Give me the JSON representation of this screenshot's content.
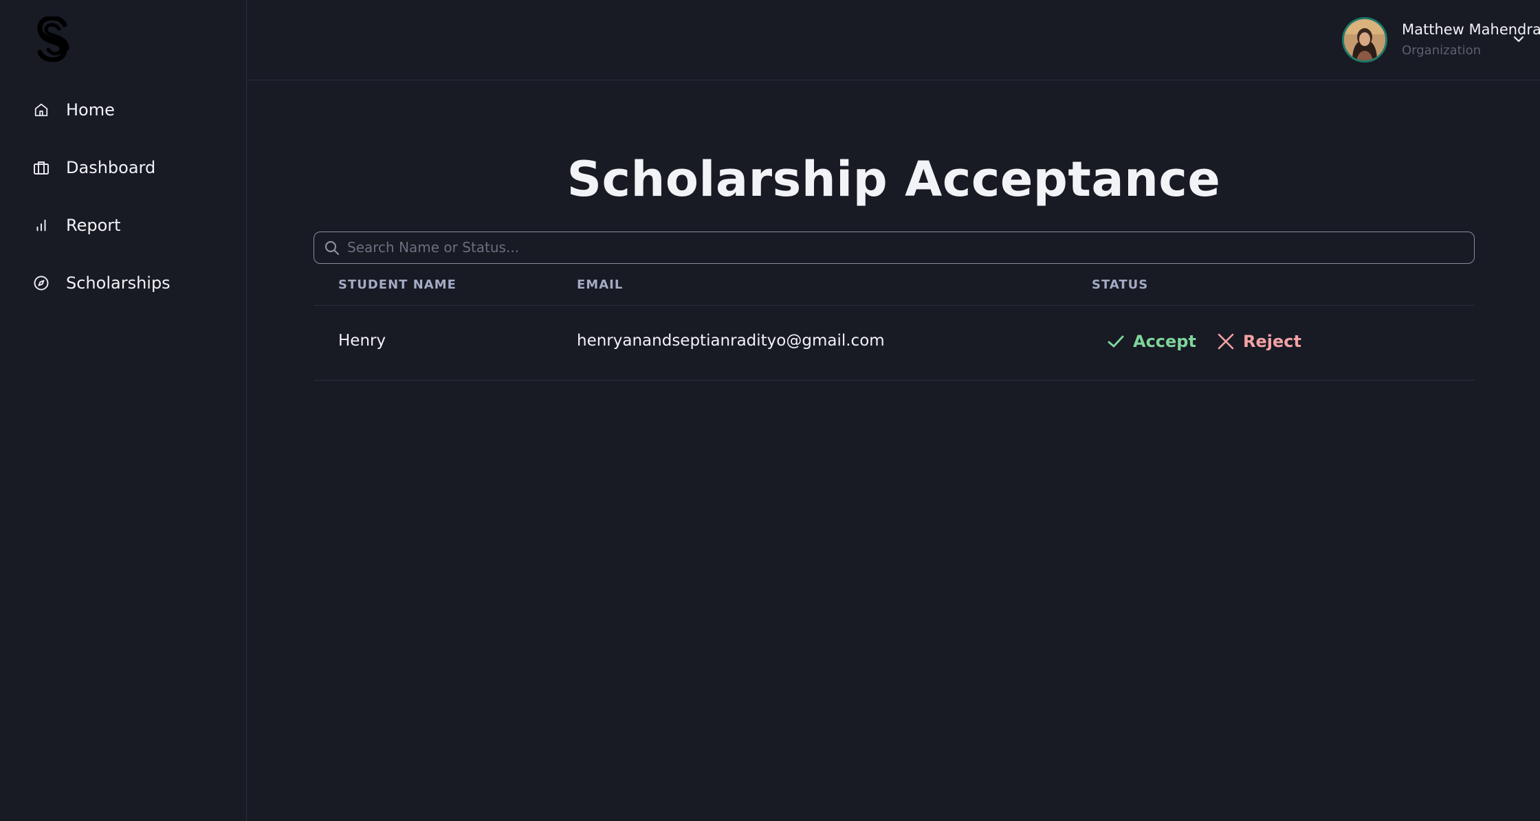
{
  "sidebar": {
    "logo_icon": "scholarship-s-logo",
    "items": [
      {
        "label": "Home",
        "icon": "home-icon"
      },
      {
        "label": "Dashboard",
        "icon": "briefcase-icon"
      },
      {
        "label": "Report",
        "icon": "bar-chart-icon"
      },
      {
        "label": "Scholarships",
        "icon": "compass-icon"
      }
    ]
  },
  "header": {
    "user": {
      "name": "Matthew Mahendra",
      "role": "Organization",
      "avatar_icon": "user-avatar",
      "menu_icon": "chevron-down-icon"
    }
  },
  "main": {
    "title": "Scholarship Acceptance",
    "search": {
      "placeholder": "Search Name or Status...",
      "value": ""
    },
    "table": {
      "columns": [
        "STUDENT NAME",
        "EMAIL",
        "STATUS"
      ],
      "rows": [
        {
          "name": "Henry",
          "email": "henryanandseptianradityo@gmail.com",
          "accept_label": "Accept",
          "reject_label": "Reject"
        }
      ]
    }
  },
  "colors": {
    "background": "#181a24",
    "border": "#2b2e3b",
    "accept": "#7fd49a",
    "reject": "#f2a3a3",
    "header_text": "#a3abc4"
  }
}
